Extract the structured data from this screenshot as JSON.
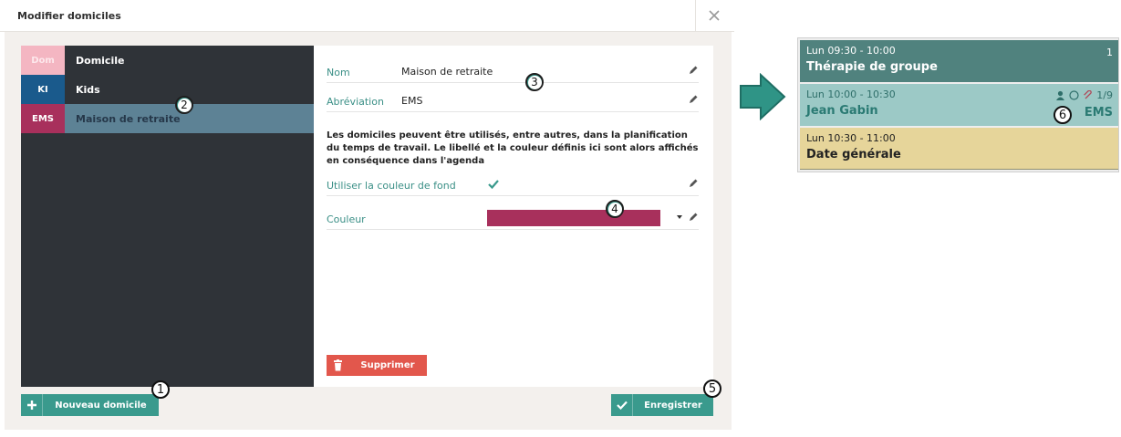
{
  "dialog": {
    "title": "Modifier domiciles",
    "close_glyph": "✕"
  },
  "domiciles": [
    {
      "abbr": "Dom",
      "label": "Domicile",
      "color": "#f4b6c2"
    },
    {
      "abbr": "KI",
      "label": "Kids",
      "color": "#1a5a8c"
    },
    {
      "abbr": "EMS",
      "label": "Maison de retraite",
      "color": "#a8305c"
    }
  ],
  "selected_index": 2,
  "form": {
    "name_label": "Nom",
    "name_value": "Maison de retraite",
    "abbr_label": "Abréviation",
    "abbr_value": "EMS",
    "info_text": "Les domiciles peuvent être utilisés, entre autres, dans la planification du temps de travail. Le libellé et la couleur définis ici sont alors affichés en conséquence dans l'agenda",
    "bg_color_label": "Utiliser la couleur de fond",
    "bg_color_checked": true,
    "color_label": "Couleur",
    "color_value": "#a8305c",
    "delete_label": "Supprimer"
  },
  "footer": {
    "new_label": "Nouveau domicile",
    "save_label": "Enregistrer"
  },
  "callouts": [
    "1",
    "2",
    "3",
    "4",
    "5",
    "6"
  ],
  "agenda": {
    "appointments": [
      {
        "time": "Lun 09:30 - 10:00",
        "title": "Thérapie de groupe",
        "count": "1"
      },
      {
        "time": "Lun 10:00 - 10:30",
        "title": "Jean Gabin",
        "count": "1/9",
        "tag": "EMS"
      },
      {
        "time": "Lun 10:30 - 11:00",
        "title": "Date générale"
      }
    ]
  },
  "colors": {
    "accent": "#3a9a8d",
    "danger": "#e2574c",
    "list_bg": "#2f3338",
    "selected_bg": "#5d8295"
  }
}
